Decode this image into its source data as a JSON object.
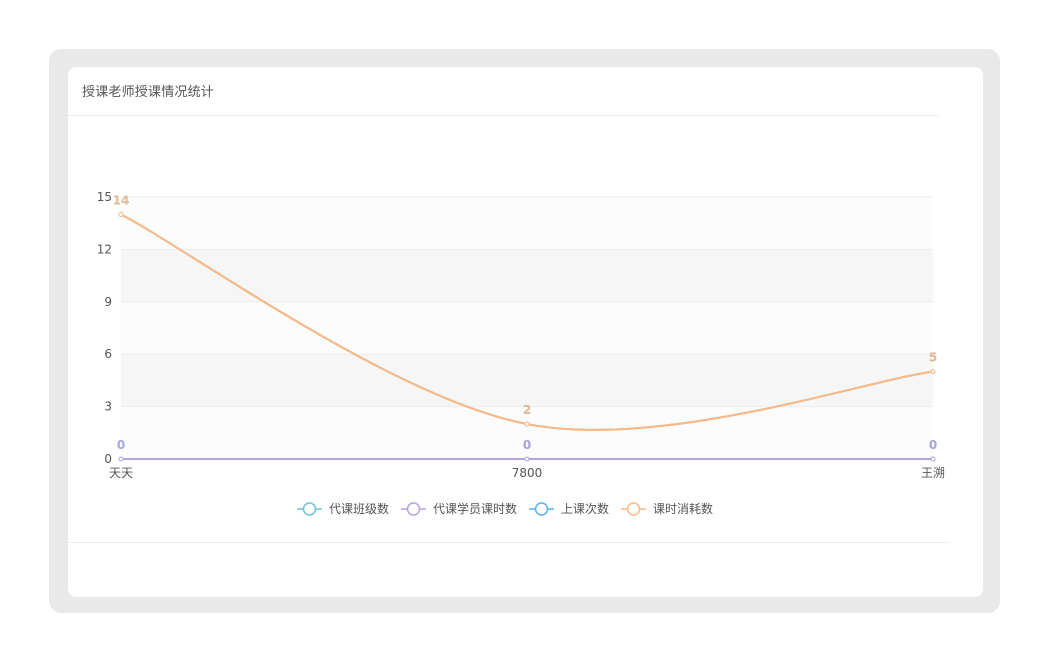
{
  "card": {
    "title": "授课老师授课情况统计"
  },
  "chart_data": {
    "type": "line",
    "title": "授课老师授课情况统计",
    "categories": [
      "天天",
      "7800",
      "王溯"
    ],
    "yticks": [
      0,
      3,
      6,
      9,
      12,
      15
    ],
    "ylim": [
      0,
      15
    ],
    "grid": true,
    "legend_position": "bottom",
    "series": [
      {
        "name": "代课班级数",
        "values": [
          0,
          0,
          0
        ],
        "color": "#6fc2d6"
      },
      {
        "name": "代课学员课时数",
        "values": [
          0,
          0,
          0
        ],
        "color": "#b6a2de"
      },
      {
        "name": "上课次数",
        "values": [
          14,
          2,
          5
        ],
        "color": "#5ab1ef"
      },
      {
        "name": "课时消耗数",
        "values": [
          14,
          2,
          5
        ],
        "color": "#ffb980"
      }
    ]
  }
}
